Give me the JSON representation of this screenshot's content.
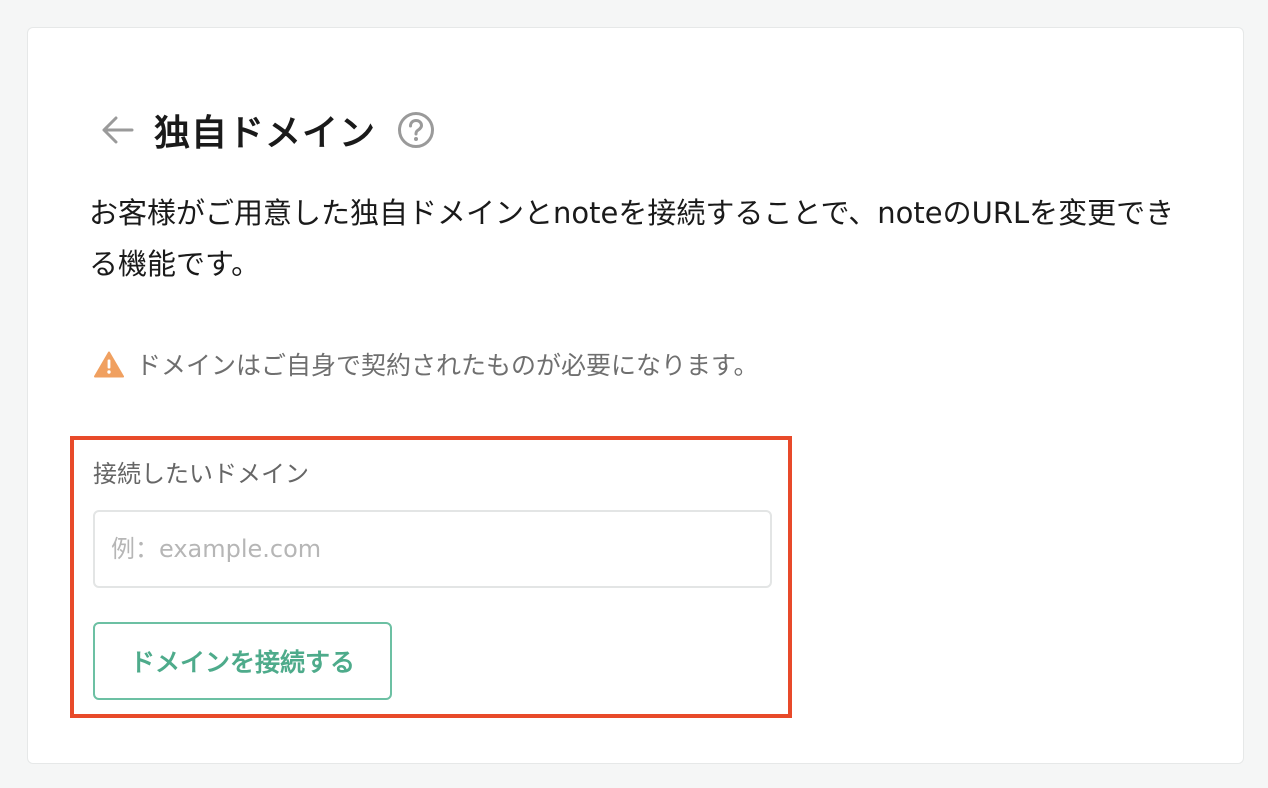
{
  "header": {
    "title": "独自ドメイン",
    "back_icon": "arrow-left-icon",
    "help_icon": "question-circle-icon"
  },
  "description": "お客様がご用意した独自ドメインとnoteを接続することで、noteのURLを変更できる機能です。",
  "warning": {
    "icon": "warning-triangle-icon",
    "text": "ドメインはご自身で契約されたものが必要になります。"
  },
  "form": {
    "label": "接続したいドメイン",
    "placeholder": "例：example.com",
    "value": "",
    "button_label": "ドメインを接続する"
  },
  "colors": {
    "accent": "#4eab8b",
    "accent_border": "#6cc0a3",
    "warning": "#f0a060",
    "highlight": "#e84a2a"
  }
}
